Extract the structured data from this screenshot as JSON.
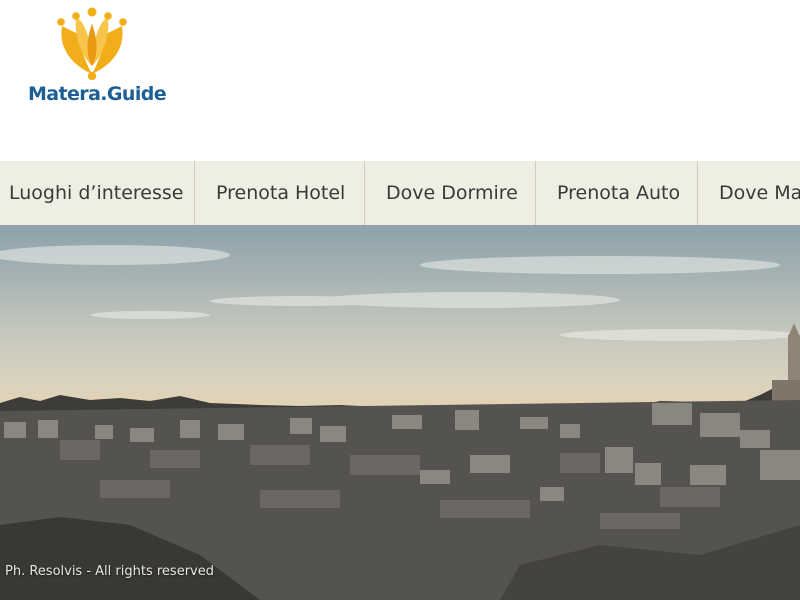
{
  "logo": {
    "text": "Matera.Guide",
    "gold": "#f2ad1b",
    "blue": "#1c5f96"
  },
  "nav": {
    "items": [
      {
        "label": "Luoghi d’interesse"
      },
      {
        "label": "Prenota Hotel"
      },
      {
        "label": "Dove Dormire"
      },
      {
        "label": "Prenota Auto"
      },
      {
        "label": "Dove Ma"
      }
    ]
  },
  "hero": {
    "caption": "Ph. Resolvis - All rights reserved"
  }
}
